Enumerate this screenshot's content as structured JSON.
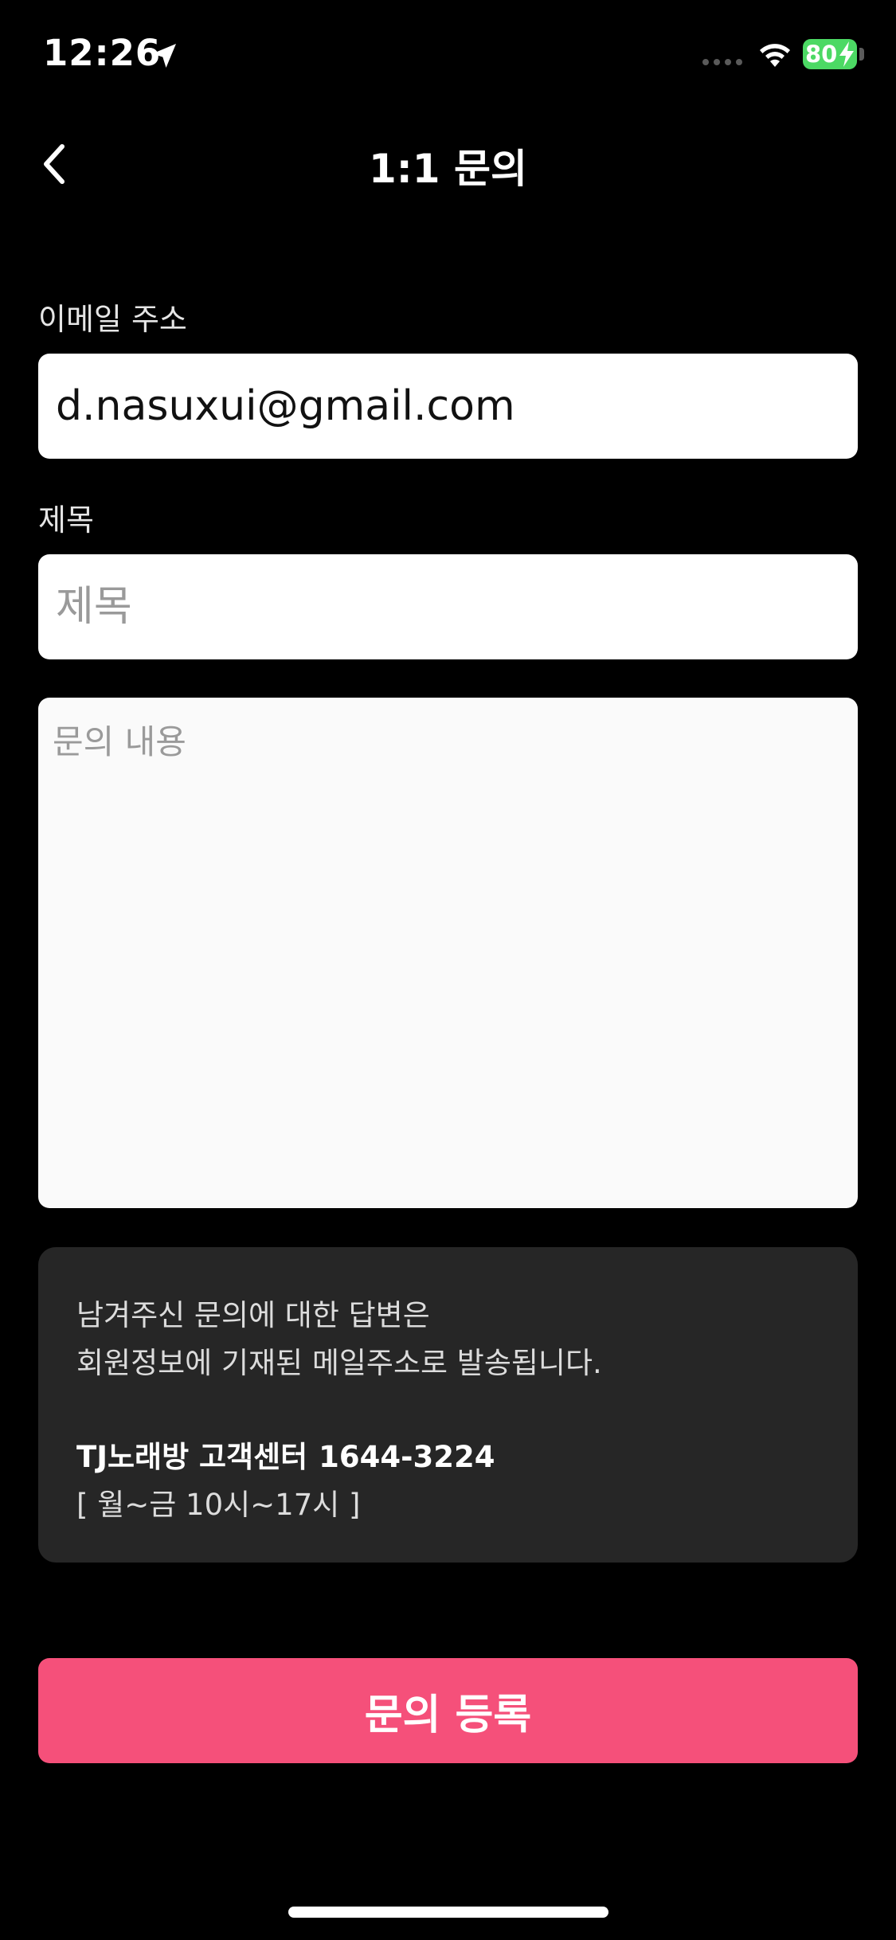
{
  "status_bar": {
    "time": "12:26",
    "battery_level": "80"
  },
  "nav": {
    "title": "1:1 문의"
  },
  "form": {
    "email_label": "이메일 주소",
    "email_value": "d.nasuxui@gmail.com",
    "subject_label": "제목",
    "subject_placeholder": "제목",
    "subject_value": "",
    "content_placeholder": "문의 내용",
    "content_value": ""
  },
  "info": {
    "line1": "남겨주신 문의에 대한 답변은",
    "line2": "회원정보에 기재된 메일주소로 발송됩니다.",
    "center_name": "TJ노래방 고객센터",
    "center_phone": "1644-3224",
    "hours": "[ 월~금 10시~17시 ]"
  },
  "actions": {
    "submit_label": "문의 등록"
  },
  "colors": {
    "background": "#000000",
    "accent": "#f5507a",
    "card": "#262626",
    "battery": "#4cd964"
  }
}
